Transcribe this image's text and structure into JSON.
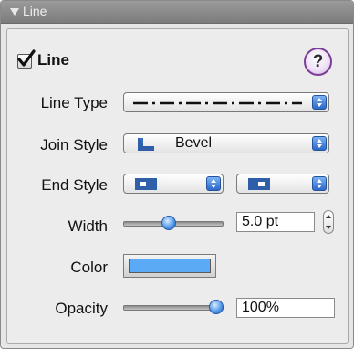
{
  "panel": {
    "title": "Line",
    "collapse_icon": "disclosure-triangle-down-icon"
  },
  "line_toggle": {
    "label": "Line",
    "checked": true
  },
  "help": {
    "label": "?"
  },
  "line_type": {
    "label": "Line Type",
    "value_icon": "dash-dot-line-icon"
  },
  "join_style": {
    "label": "Join Style",
    "value": "Bevel",
    "value_icon": "bevel-join-icon"
  },
  "end_style": {
    "label": "End Style",
    "start_icon": "square-cap-start-icon",
    "end_icon": "square-cap-end-icon"
  },
  "width": {
    "label": "Width",
    "value": "5.0 pt",
    "slider_fraction": 0.45
  },
  "color": {
    "label": "Color",
    "value": "#5aaaf5"
  },
  "opacity": {
    "label": "Opacity",
    "value": "100%",
    "slider_fraction": 1.0
  },
  "accent_color": "#3b7fdc"
}
